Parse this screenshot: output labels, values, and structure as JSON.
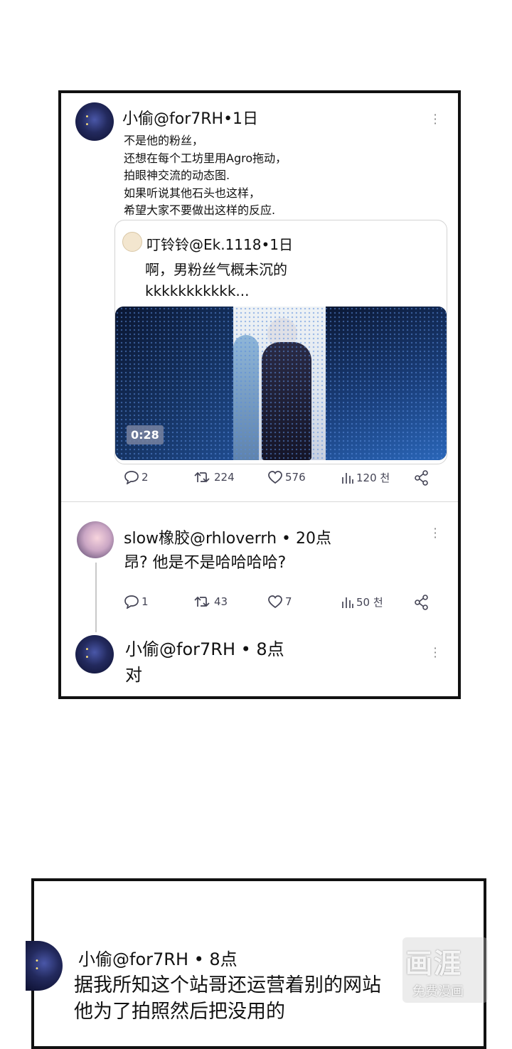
{
  "post": {
    "author": "小偷@for7RH•1日",
    "text": "不是他的粉丝，\n还想在每个工坊里用Agro拖动，\n拍眼神交流的动态图.\n如果听说其他石头也这样，\n希望大家不要做出这样的反应.",
    "quote": {
      "author": "叮铃铃@Ek.1118•1日",
      "text": "啊，男粉丝气概未沉的\nkkkkkkkkkkk...",
      "video_duration": "0:28"
    },
    "stats": {
      "replies": "2",
      "retweets": "224",
      "likes": "576",
      "views": "120 천"
    }
  },
  "reply": {
    "author": "slow橡胶@rhloverrh • 20点",
    "text": "昂? 他是不是哈哈哈哈?",
    "stats": {
      "replies": "1",
      "retweets": "43",
      "likes": "7",
      "views": "50 천"
    }
  },
  "reply2": {
    "author": "小偷@for7RH • 8点",
    "text": "对"
  },
  "panel2": {
    "author": "小偷@for7RH • 8点",
    "text": "据我所知这个站哥还运营着别的网站\n他为了拍照然后把没用的"
  },
  "watermark": {
    "big": "画涯",
    "small": "免费漫画"
  }
}
